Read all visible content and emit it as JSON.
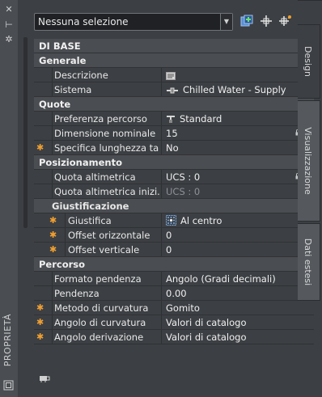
{
  "palette": {
    "title": "PROPRIETÀ"
  },
  "toolbar": {
    "selection_value": "Nessuna selezione"
  },
  "tabs": [
    "Design",
    "Visualizzazione",
    "Dati estesi"
  ],
  "sections": {
    "base": {
      "label": "DI BASE"
    },
    "generale": {
      "label": "Generale",
      "descrizione": {
        "label": "Descrizione",
        "value": ""
      },
      "sistema": {
        "label": "Sistema",
        "value": "Chilled Water - Supply"
      }
    },
    "quote": {
      "label": "Quote",
      "preferenza": {
        "label": "Preferenza percorso",
        "value": "Standard"
      },
      "dimensione": {
        "label": "Dimensione nominale",
        "value": "15"
      },
      "specifica": {
        "label": "Specifica lunghezza ta...",
        "value": "No"
      }
    },
    "posizionamento": {
      "label": "Posizionamento",
      "quota_alt": {
        "label": "Quota altimetrica",
        "value": "UCS : 0"
      },
      "quota_alt_iniz": {
        "label": "Quota altimetrica inizi...",
        "value": "UCS : 0"
      },
      "giustificazione": {
        "label": "Giustificazione",
        "giustifica": {
          "label": "Giustifica",
          "value": "Al centro"
        },
        "offset_oriz": {
          "label": "Offset orizzontale",
          "value": "0"
        },
        "offset_vert": {
          "label": "Offset verticale",
          "value": "0"
        }
      }
    },
    "percorso": {
      "label": "Percorso",
      "formato": {
        "label": "Formato pendenza",
        "value": "Angolo (Gradi decimali)"
      },
      "pendenza": {
        "label": "Pendenza",
        "value": "0.00"
      },
      "metodo": {
        "label": "Metodo di curvatura",
        "value": "Gomito"
      },
      "angolo_curv": {
        "label": "Angolo di curvatura",
        "value": "Valori di catalogo"
      },
      "angolo_der": {
        "label": "Angolo derivazione",
        "value": "Valori di catalogo"
      }
    }
  },
  "icons": {
    "asterisk_color": "#f0a030",
    "collapse_glyph": "−"
  }
}
